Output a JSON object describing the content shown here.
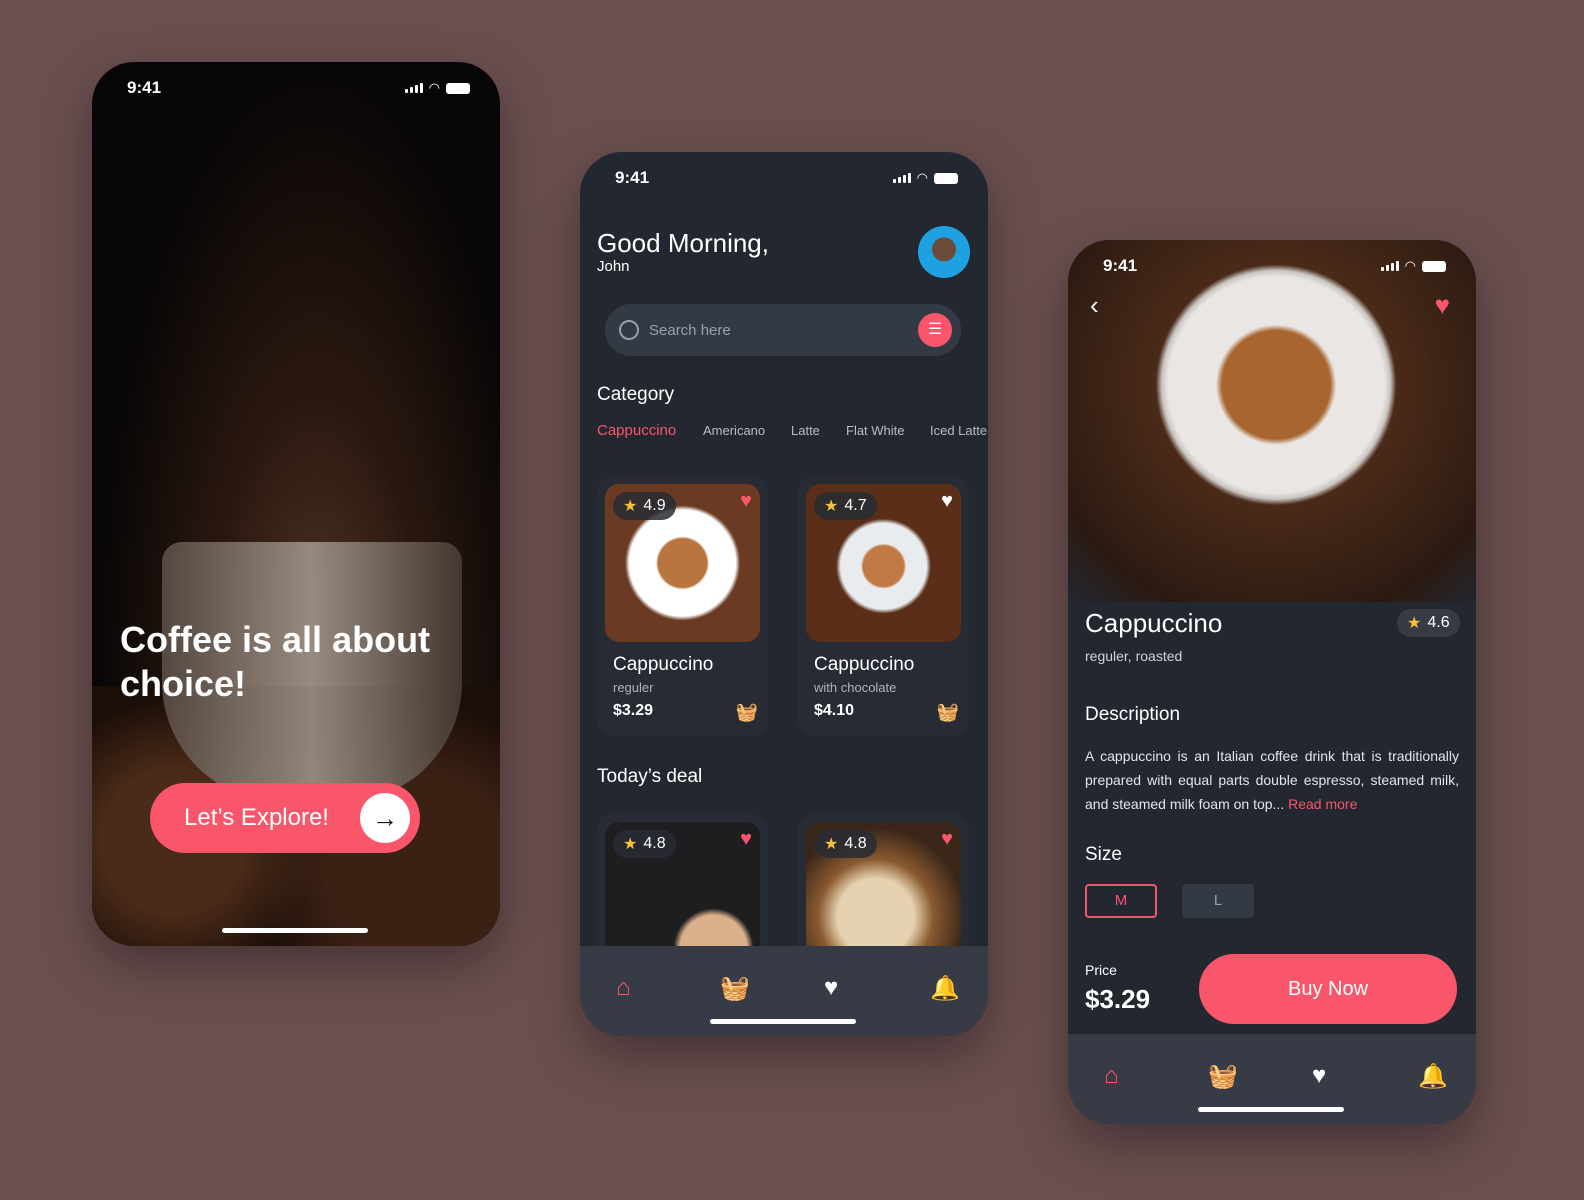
{
  "colors": {
    "accent": "#f9566b",
    "background": "#6b4f50",
    "surface": "#222730"
  },
  "splash": {
    "time": "9:41",
    "headline": "Coffee is all about choice!",
    "button": "Let’s Explore!",
    "arrow_icon": "arrow-right-icon"
  },
  "home": {
    "time": "9:41",
    "greeting": "Good Morning,",
    "user": "John",
    "search_placeholder": "Search here",
    "category_title": "Category",
    "categories": [
      "Cappuccino",
      "Americano",
      "Latte",
      "Flat White",
      "Iced Latte"
    ],
    "products": [
      {
        "rating": "4.9",
        "name": "Cappuccino",
        "sub": "reguler",
        "price": "$3.29",
        "favorite": true
      },
      {
        "rating": "4.7",
        "name": "Cappuccino",
        "sub": "with chocolate",
        "price": "$4.10",
        "favorite": false
      }
    ],
    "deal_title": "Today’s deal",
    "deals": [
      {
        "rating": "4.8",
        "favorite": true
      },
      {
        "rating": "4.8",
        "favorite": true
      }
    ]
  },
  "detail": {
    "time": "9:41",
    "name": "Cappuccino",
    "rating": "4.6",
    "sub": "reguler, roasted",
    "desc_title": "Description",
    "desc": "A cappuccino is an Italian coffee drink that is traditionally prepared with equal parts double espresso, steamed milk, and steamed milk foam on top...",
    "read_more": "Read more",
    "size_title": "Size",
    "sizes": [
      "M",
      "L"
    ],
    "selected_size": "M",
    "price_label": "Price",
    "price": "$3.29",
    "buy": "Buy Now"
  }
}
